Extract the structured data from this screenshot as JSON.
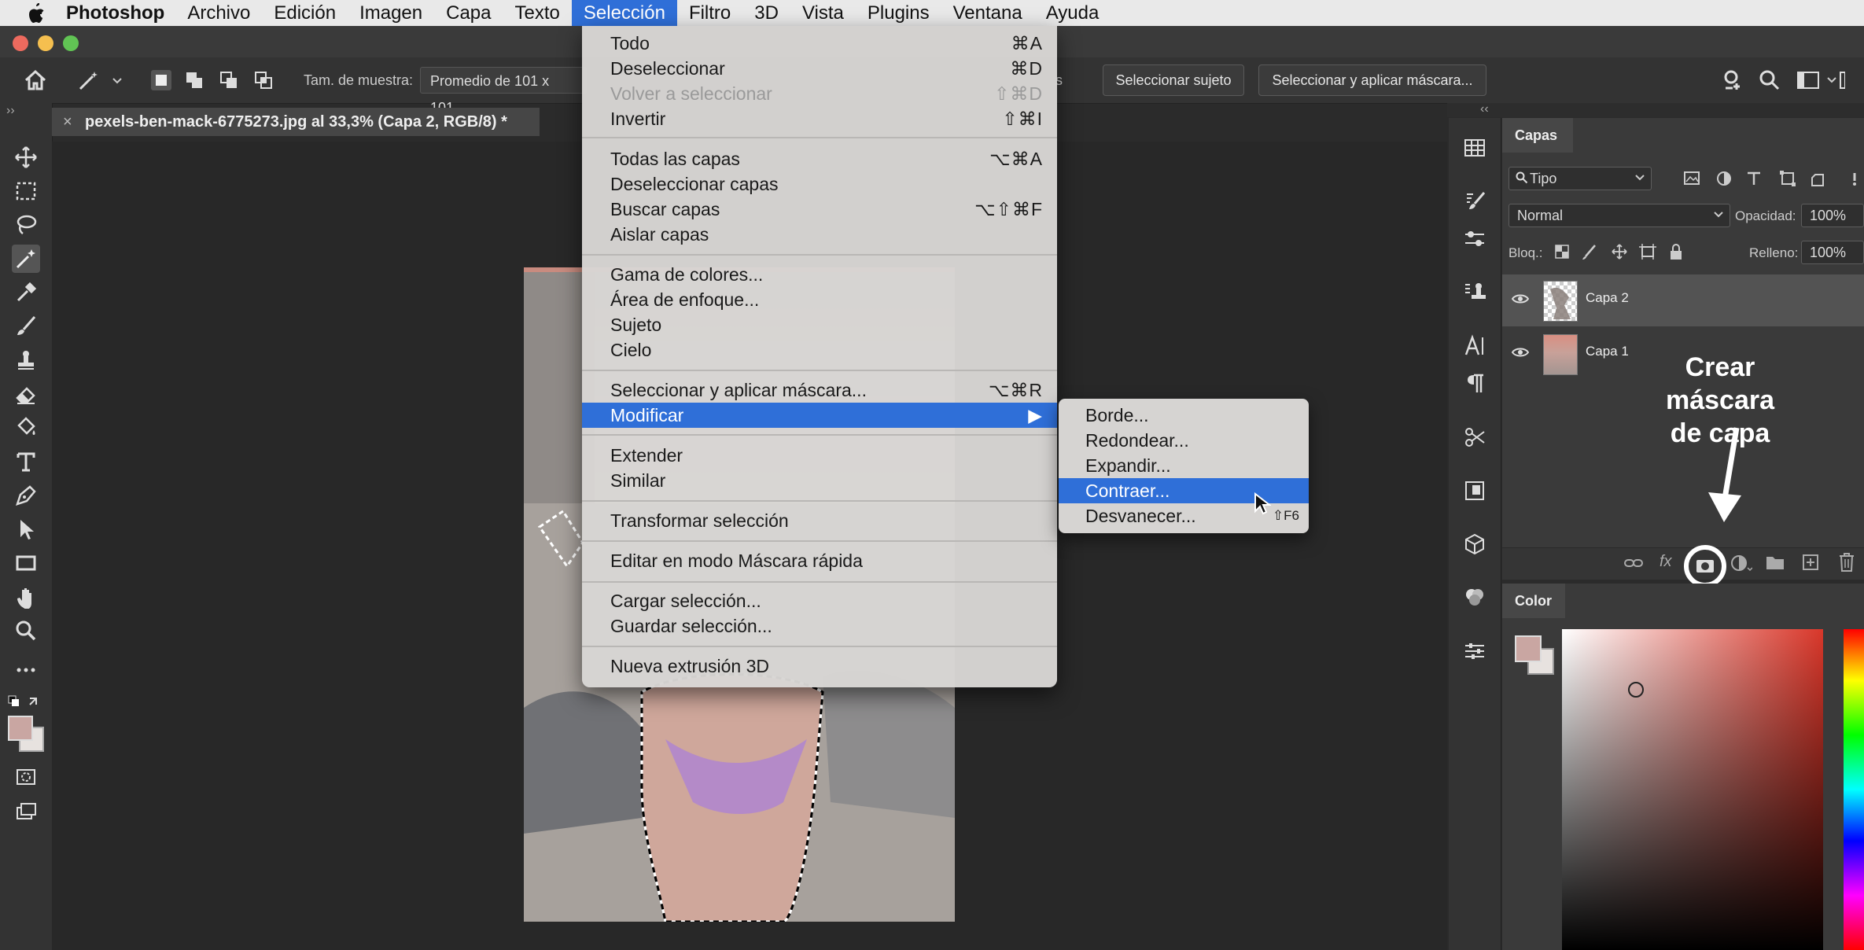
{
  "menubar": {
    "app_name": "Photoshop",
    "items": [
      "Archivo",
      "Edición",
      "Imagen",
      "Capa",
      "Texto",
      "Selección",
      "Filtro",
      "3D",
      "Vista",
      "Plugins",
      "Ventana",
      "Ayuda"
    ],
    "active": "Selección"
  },
  "options": {
    "sample_size_label": "Tam. de muestra:",
    "sample_size_value": "Promedio de 101 x 101",
    "partial_text": "s",
    "select_subject": "Seleccionar sujeto",
    "select_and_mask": "Seleccionar y aplicar máscara..."
  },
  "document": {
    "tab_title": "pexels-ben-mack-6775273.jpg al 33,3% (Capa 2, RGB/8) *",
    "close_glyph": "×"
  },
  "selection_menu": {
    "items": [
      {
        "label": "Todo",
        "shortcut": "⌘A",
        "disabled": false
      },
      {
        "label": "Deseleccionar",
        "shortcut": "⌘D",
        "disabled": false
      },
      {
        "label": "Volver a seleccionar",
        "shortcut": "⇧⌘D",
        "disabled": true
      },
      {
        "label": "Invertir",
        "shortcut": "⇧⌘I",
        "disabled": false
      },
      {
        "label": "Todas las capas",
        "shortcut": "⌥⌘A",
        "disabled": false
      },
      {
        "label": "Deseleccionar capas",
        "shortcut": "",
        "disabled": false
      },
      {
        "label": "Buscar capas",
        "shortcut": "⌥⇧⌘F",
        "disabled": false
      },
      {
        "label": "Aislar capas",
        "shortcut": "",
        "disabled": false
      },
      {
        "label": "Gama de colores...",
        "shortcut": "",
        "disabled": false
      },
      {
        "label": "Área de enfoque...",
        "shortcut": "",
        "disabled": false
      },
      {
        "label": "Sujeto",
        "shortcut": "",
        "disabled": false
      },
      {
        "label": "Cielo",
        "shortcut": "",
        "disabled": false
      },
      {
        "label": "Seleccionar y aplicar máscara...",
        "shortcut": "⌥⌘R",
        "disabled": false
      },
      {
        "label": "Modificar",
        "shortcut": "▶",
        "disabled": false,
        "highlighted": true
      },
      {
        "label": "Extender",
        "shortcut": "",
        "disabled": false
      },
      {
        "label": "Similar",
        "shortcut": "",
        "disabled": false
      },
      {
        "label": "Transformar selección",
        "shortcut": "",
        "disabled": false
      },
      {
        "label": "Editar en modo Máscara rápida",
        "shortcut": "",
        "disabled": false
      },
      {
        "label": "Cargar selección...",
        "shortcut": "",
        "disabled": false
      },
      {
        "label": "Guardar selección...",
        "shortcut": "",
        "disabled": false
      },
      {
        "label": "Nueva extrusión 3D",
        "shortcut": "",
        "disabled": false
      }
    ]
  },
  "modify_submenu": {
    "items": [
      {
        "label": "Borde...",
        "shortcut": ""
      },
      {
        "label": "Redondear...",
        "shortcut": ""
      },
      {
        "label": "Expandir...",
        "shortcut": ""
      },
      {
        "label": "Contraer...",
        "shortcut": "",
        "highlighted": true
      },
      {
        "label": "Desvanecer...",
        "shortcut": "⇧F6"
      }
    ]
  },
  "layers_panel": {
    "tab": "Capas",
    "filter": "Tipo",
    "blend_mode": "Normal",
    "opacity_label": "Opacidad:",
    "opacity_value": "100%",
    "lock_label": "Bloq.:",
    "fill_label": "Relleno:",
    "fill_value": "100%",
    "layers": [
      {
        "name": "Capa 2",
        "selected": true,
        "visible": true
      },
      {
        "name": "Capa 1",
        "selected": false,
        "visible": true
      }
    ]
  },
  "color_panel": {
    "tab": "Color"
  },
  "annotation": {
    "line1": "Crear máscara",
    "line2": "de capa"
  },
  "colors": {
    "menu_highlight": "#2f6fd8",
    "foreground_swatch": "#c9a6a2",
    "background_swatch": "#e7e2df",
    "panel_bg": "#3a3a3a"
  }
}
